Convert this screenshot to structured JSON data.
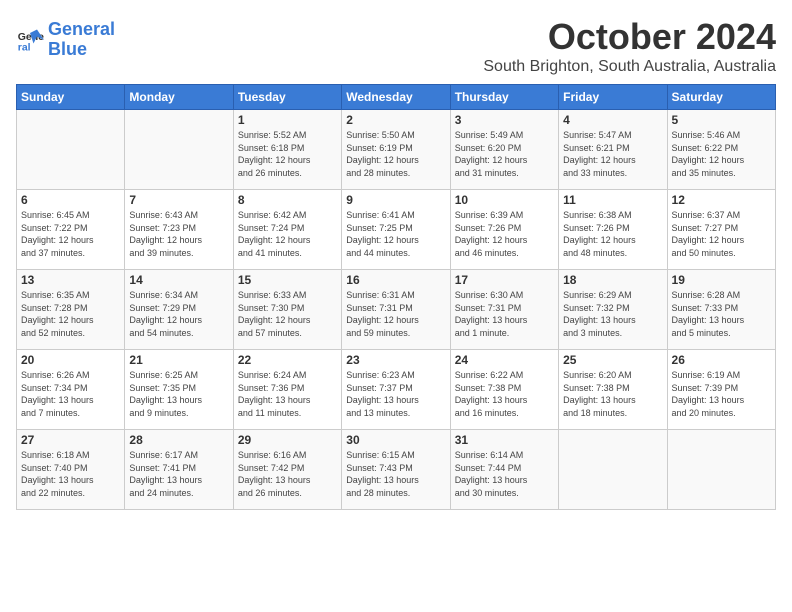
{
  "logo": {
    "line1": "General",
    "line2": "Blue"
  },
  "header": {
    "month": "October 2024",
    "location": "South Brighton, South Australia, Australia"
  },
  "weekdays": [
    "Sunday",
    "Monday",
    "Tuesday",
    "Wednesday",
    "Thursday",
    "Friday",
    "Saturday"
  ],
  "weeks": [
    [
      {
        "day": "",
        "content": ""
      },
      {
        "day": "",
        "content": ""
      },
      {
        "day": "1",
        "content": "Sunrise: 5:52 AM\nSunset: 6:18 PM\nDaylight: 12 hours\nand 26 minutes."
      },
      {
        "day": "2",
        "content": "Sunrise: 5:50 AM\nSunset: 6:19 PM\nDaylight: 12 hours\nand 28 minutes."
      },
      {
        "day": "3",
        "content": "Sunrise: 5:49 AM\nSunset: 6:20 PM\nDaylight: 12 hours\nand 31 minutes."
      },
      {
        "day": "4",
        "content": "Sunrise: 5:47 AM\nSunset: 6:21 PM\nDaylight: 12 hours\nand 33 minutes."
      },
      {
        "day": "5",
        "content": "Sunrise: 5:46 AM\nSunset: 6:22 PM\nDaylight: 12 hours\nand 35 minutes."
      }
    ],
    [
      {
        "day": "6",
        "content": "Sunrise: 6:45 AM\nSunset: 7:22 PM\nDaylight: 12 hours\nand 37 minutes."
      },
      {
        "day": "7",
        "content": "Sunrise: 6:43 AM\nSunset: 7:23 PM\nDaylight: 12 hours\nand 39 minutes."
      },
      {
        "day": "8",
        "content": "Sunrise: 6:42 AM\nSunset: 7:24 PM\nDaylight: 12 hours\nand 41 minutes."
      },
      {
        "day": "9",
        "content": "Sunrise: 6:41 AM\nSunset: 7:25 PM\nDaylight: 12 hours\nand 44 minutes."
      },
      {
        "day": "10",
        "content": "Sunrise: 6:39 AM\nSunset: 7:26 PM\nDaylight: 12 hours\nand 46 minutes."
      },
      {
        "day": "11",
        "content": "Sunrise: 6:38 AM\nSunset: 7:26 PM\nDaylight: 12 hours\nand 48 minutes."
      },
      {
        "day": "12",
        "content": "Sunrise: 6:37 AM\nSunset: 7:27 PM\nDaylight: 12 hours\nand 50 minutes."
      }
    ],
    [
      {
        "day": "13",
        "content": "Sunrise: 6:35 AM\nSunset: 7:28 PM\nDaylight: 12 hours\nand 52 minutes."
      },
      {
        "day": "14",
        "content": "Sunrise: 6:34 AM\nSunset: 7:29 PM\nDaylight: 12 hours\nand 54 minutes."
      },
      {
        "day": "15",
        "content": "Sunrise: 6:33 AM\nSunset: 7:30 PM\nDaylight: 12 hours\nand 57 minutes."
      },
      {
        "day": "16",
        "content": "Sunrise: 6:31 AM\nSunset: 7:31 PM\nDaylight: 12 hours\nand 59 minutes."
      },
      {
        "day": "17",
        "content": "Sunrise: 6:30 AM\nSunset: 7:31 PM\nDaylight: 13 hours\nand 1 minute."
      },
      {
        "day": "18",
        "content": "Sunrise: 6:29 AM\nSunset: 7:32 PM\nDaylight: 13 hours\nand 3 minutes."
      },
      {
        "day": "19",
        "content": "Sunrise: 6:28 AM\nSunset: 7:33 PM\nDaylight: 13 hours\nand 5 minutes."
      }
    ],
    [
      {
        "day": "20",
        "content": "Sunrise: 6:26 AM\nSunset: 7:34 PM\nDaylight: 13 hours\nand 7 minutes."
      },
      {
        "day": "21",
        "content": "Sunrise: 6:25 AM\nSunset: 7:35 PM\nDaylight: 13 hours\nand 9 minutes."
      },
      {
        "day": "22",
        "content": "Sunrise: 6:24 AM\nSunset: 7:36 PM\nDaylight: 13 hours\nand 11 minutes."
      },
      {
        "day": "23",
        "content": "Sunrise: 6:23 AM\nSunset: 7:37 PM\nDaylight: 13 hours\nand 13 minutes."
      },
      {
        "day": "24",
        "content": "Sunrise: 6:22 AM\nSunset: 7:38 PM\nDaylight: 13 hours\nand 16 minutes."
      },
      {
        "day": "25",
        "content": "Sunrise: 6:20 AM\nSunset: 7:38 PM\nDaylight: 13 hours\nand 18 minutes."
      },
      {
        "day": "26",
        "content": "Sunrise: 6:19 AM\nSunset: 7:39 PM\nDaylight: 13 hours\nand 20 minutes."
      }
    ],
    [
      {
        "day": "27",
        "content": "Sunrise: 6:18 AM\nSunset: 7:40 PM\nDaylight: 13 hours\nand 22 minutes."
      },
      {
        "day": "28",
        "content": "Sunrise: 6:17 AM\nSunset: 7:41 PM\nDaylight: 13 hours\nand 24 minutes."
      },
      {
        "day": "29",
        "content": "Sunrise: 6:16 AM\nSunset: 7:42 PM\nDaylight: 13 hours\nand 26 minutes."
      },
      {
        "day": "30",
        "content": "Sunrise: 6:15 AM\nSunset: 7:43 PM\nDaylight: 13 hours\nand 28 minutes."
      },
      {
        "day": "31",
        "content": "Sunrise: 6:14 AM\nSunset: 7:44 PM\nDaylight: 13 hours\nand 30 minutes."
      },
      {
        "day": "",
        "content": ""
      },
      {
        "day": "",
        "content": ""
      }
    ]
  ]
}
